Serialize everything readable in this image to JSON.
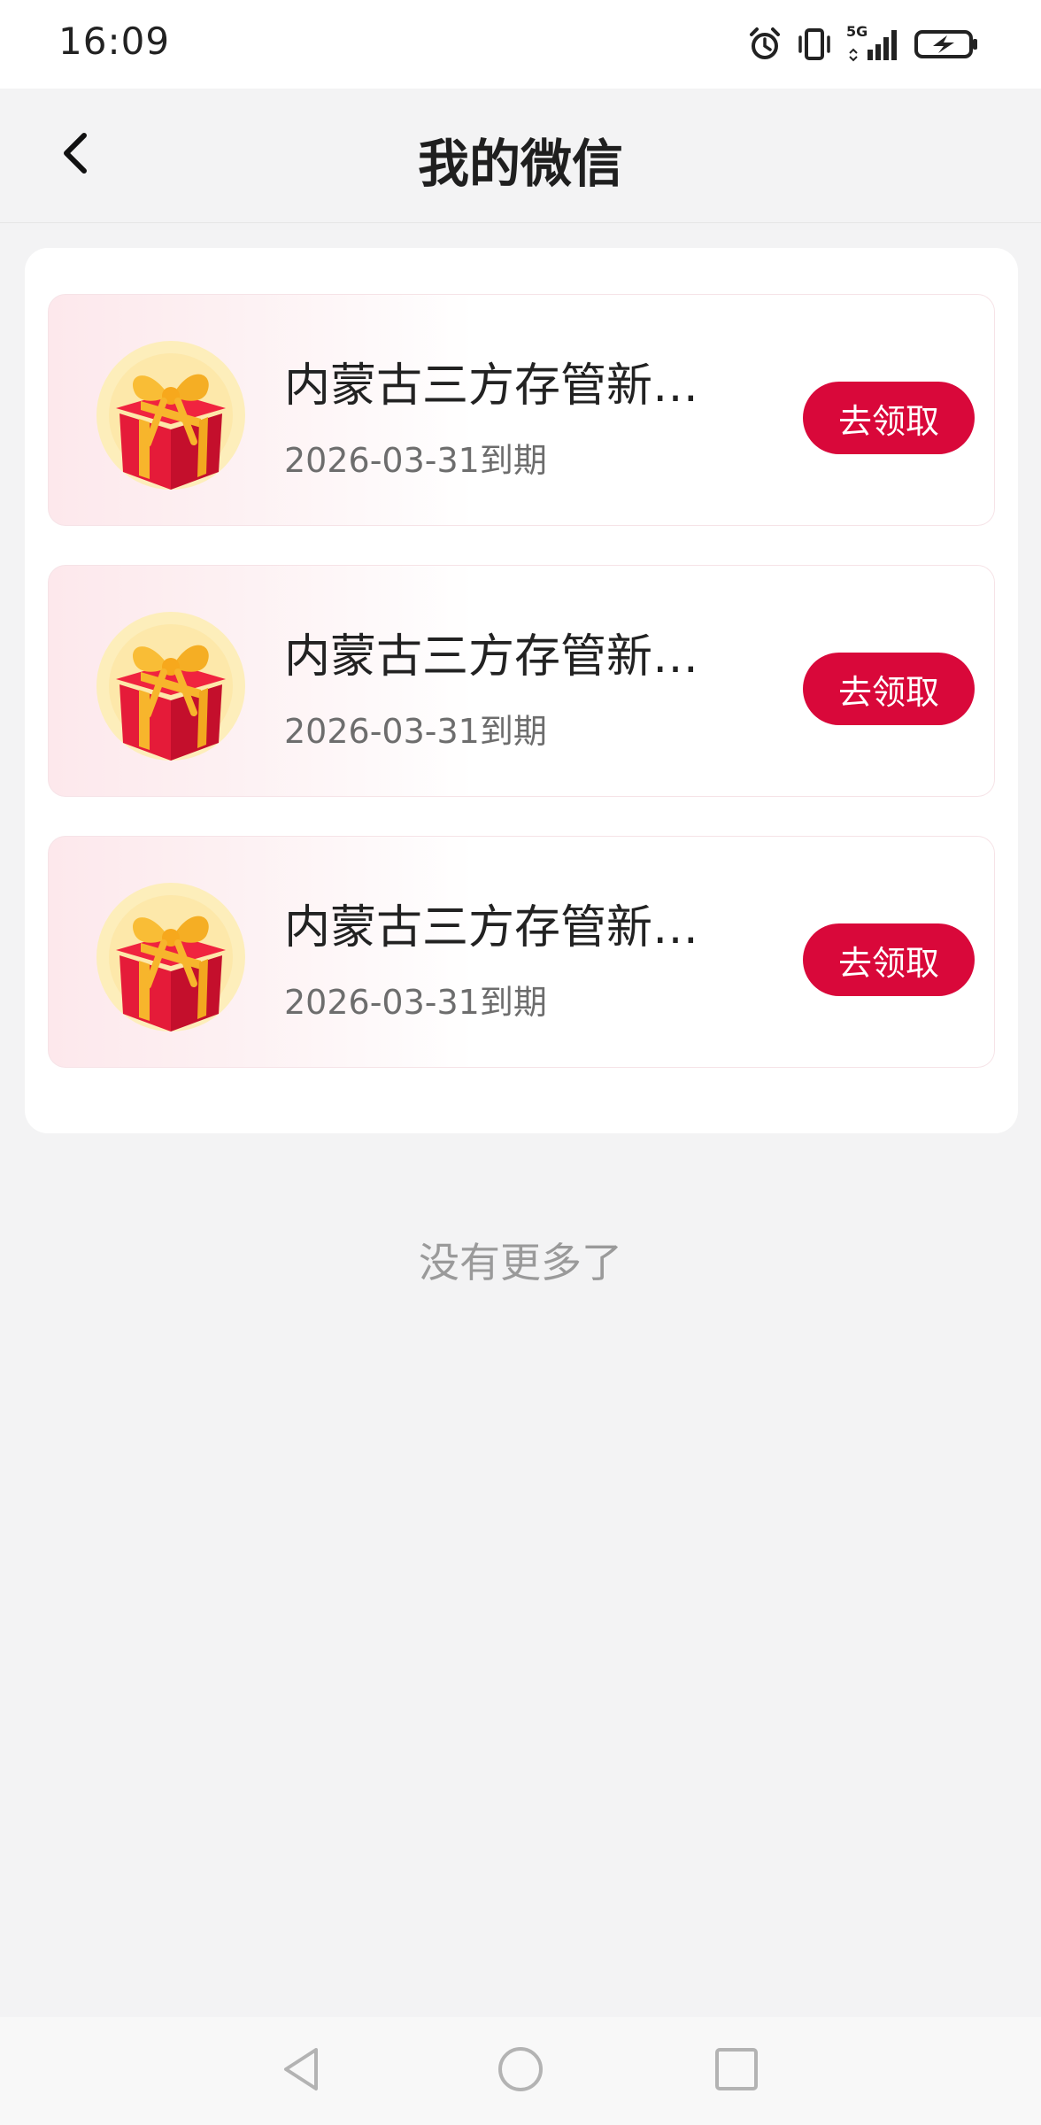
{
  "status_bar": {
    "time": "16:09",
    "network": "5G",
    "icons": [
      "alarm-icon",
      "vibrate-icon",
      "signal-icon",
      "battery-charging-icon"
    ]
  },
  "header": {
    "title": "我的微信",
    "back_icon": "back-arrow-icon"
  },
  "coupons": [
    {
      "title": "内蒙古三方存管新…",
      "expiry": "2026-03-31到期",
      "button": "去领取",
      "icon": "gift-box-icon"
    },
    {
      "title": "内蒙古三方存管新…",
      "expiry": "2026-03-31到期",
      "button": "去领取",
      "icon": "gift-box-icon"
    },
    {
      "title": "内蒙古三方存管新…",
      "expiry": "2026-03-31到期",
      "button": "去领取",
      "icon": "gift-box-icon"
    }
  ],
  "footer_text": "没有更多了",
  "system_nav": {
    "icons": [
      "back-triangle-icon",
      "home-circle-icon",
      "recents-square-icon"
    ]
  },
  "colors": {
    "accent": "#d9083a",
    "background": "#f3f3f4",
    "card": "#ffffff"
  }
}
